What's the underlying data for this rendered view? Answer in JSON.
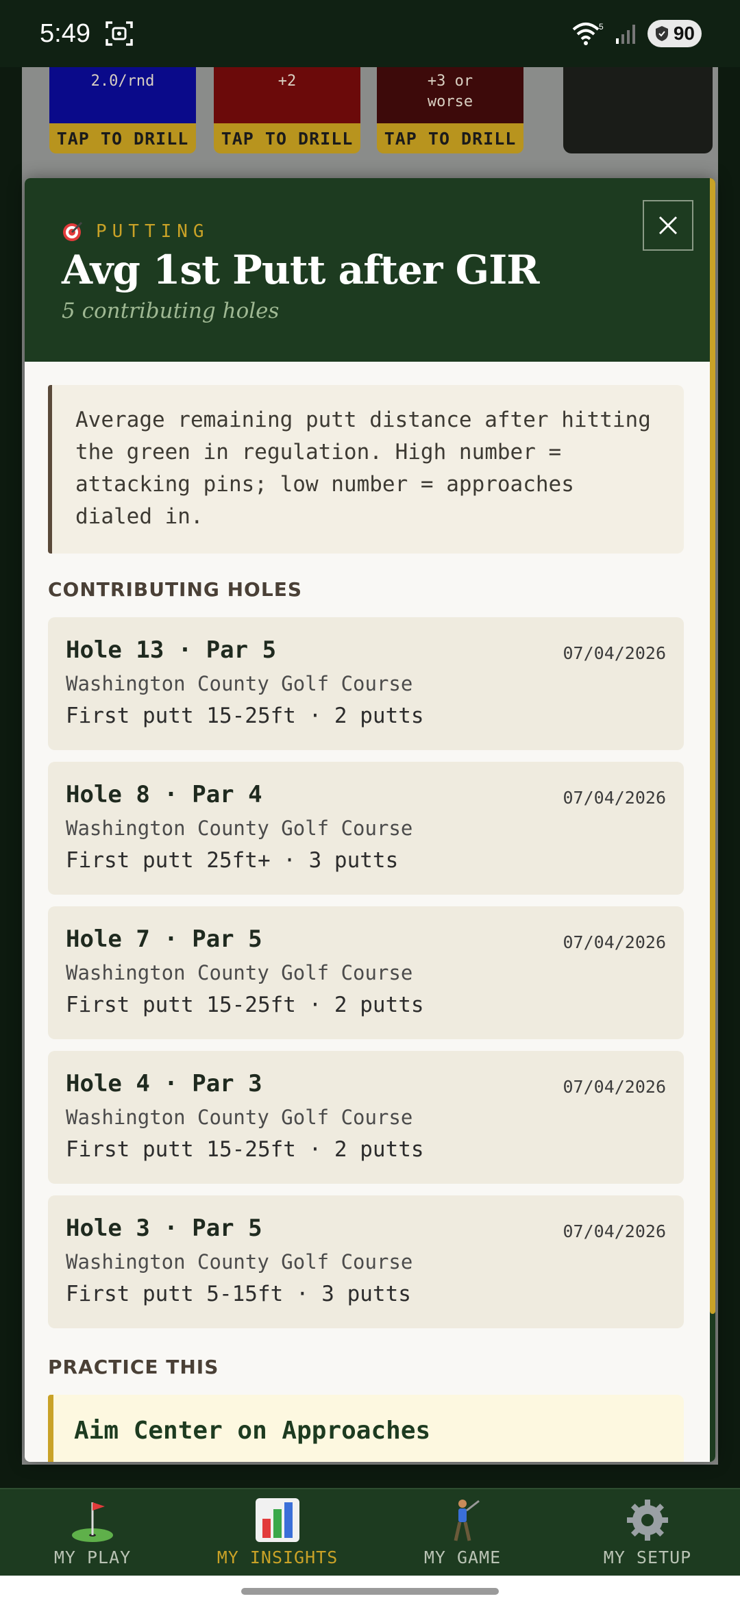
{
  "status_bar": {
    "time": "5:49",
    "wifi_badge": "5",
    "battery": "90"
  },
  "background": {
    "drills": [
      {
        "top_text": "2.0/rnd",
        "action": "TAP TO DRILL",
        "color": "#0a0a8a"
      },
      {
        "top_text": "+2",
        "action": "TAP TO DRILL",
        "color": "#6b0a0a"
      },
      {
        "top_text": "+3 or\nworse",
        "action": "TAP TO DRILL",
        "color": "#3d0a0a"
      }
    ]
  },
  "modal": {
    "category_icon": "target-icon",
    "category": "PUTTING",
    "title": "Avg 1st Putt after GIR",
    "subtitle": "5 contributing holes",
    "close_icon": "close-icon",
    "description": "Average remaining putt distance after hitting the green in regulation. High number = attacking pins; low number = approaches dialed in.",
    "holes_heading": "CONTRIBUTING HOLES",
    "holes": [
      {
        "title": "Hole 13 · Par 5",
        "date": "07/04/2026",
        "course": "Washington County Golf Course",
        "result": "First putt 15-25ft · 2 putts"
      },
      {
        "title": "Hole 8 · Par 4",
        "date": "07/04/2026",
        "course": "Washington County Golf Course",
        "result": "First putt 25ft+ · 3 putts"
      },
      {
        "title": "Hole 7 · Par 5",
        "date": "07/04/2026",
        "course": "Washington County Golf Course",
        "result": "First putt 15-25ft · 2 putts"
      },
      {
        "title": "Hole 4 · Par 3",
        "date": "07/04/2026",
        "course": "Washington County Golf Course",
        "result": "First putt 15-25ft · 2 putts"
      },
      {
        "title": "Hole 3 · Par 5",
        "date": "07/04/2026",
        "course": "Washington County Golf Course",
        "result": "First putt 5-15ft · 3 putts"
      }
    ],
    "practice_heading": "PRACTICE THIS",
    "practice_item": "Aim Center on Approaches"
  },
  "nav": {
    "items": [
      {
        "label": "MY PLAY",
        "icon": "golf-flag-icon",
        "active": false
      },
      {
        "label": "MY INSIGHTS",
        "icon": "bar-chart-icon",
        "active": true
      },
      {
        "label": "MY GAME",
        "icon": "golfer-icon",
        "active": false
      },
      {
        "label": "MY SETUP",
        "icon": "gear-icon",
        "active": false
      }
    ]
  },
  "colors": {
    "accent": "#c9a227",
    "header_green": "#1d3b20"
  }
}
